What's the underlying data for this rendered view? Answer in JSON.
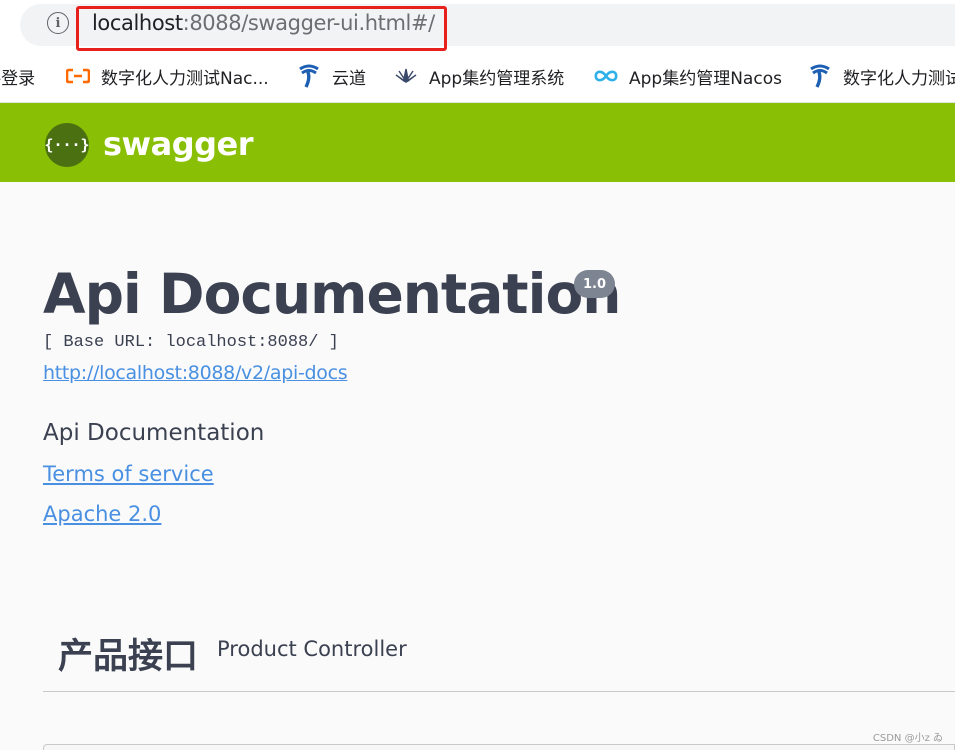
{
  "browser": {
    "url_host": "localhost",
    "url_path": ":8088/swagger-ui.html#/",
    "info_icon": "i",
    "bookmarks": [
      {
        "label": "-登录",
        "icon": "none"
      },
      {
        "label": "数字化人力测试Nac...",
        "icon": "alibaba-cloud-icon"
      },
      {
        "label": "云道",
        "icon": "china-telecom-icon"
      },
      {
        "label": "App集约管理系统",
        "icon": "lotus-icon"
      },
      {
        "label": "App集约管理Nacos",
        "icon": "infinity-icon"
      },
      {
        "label": "数字化人力测试",
        "icon": "china-telecom-icon"
      }
    ],
    "highlight_color": "#e8201c"
  },
  "topbar": {
    "logo_glyph": "{···}",
    "logo_text": "swagger",
    "color": "#89bf04"
  },
  "info": {
    "title": "Api Documentation",
    "version": "1.0",
    "base_url": "[ Base URL: localhost:8088/ ]",
    "spec_url": "http://localhost:8088/v2/api-docs",
    "description": "Api Documentation",
    "terms_label": "Terms of service",
    "license_label": "Apache 2.0"
  },
  "tags": [
    {
      "name": "产品接口",
      "description": "Product Controller"
    }
  ],
  "watermark": "CSDN @小z ゐ"
}
